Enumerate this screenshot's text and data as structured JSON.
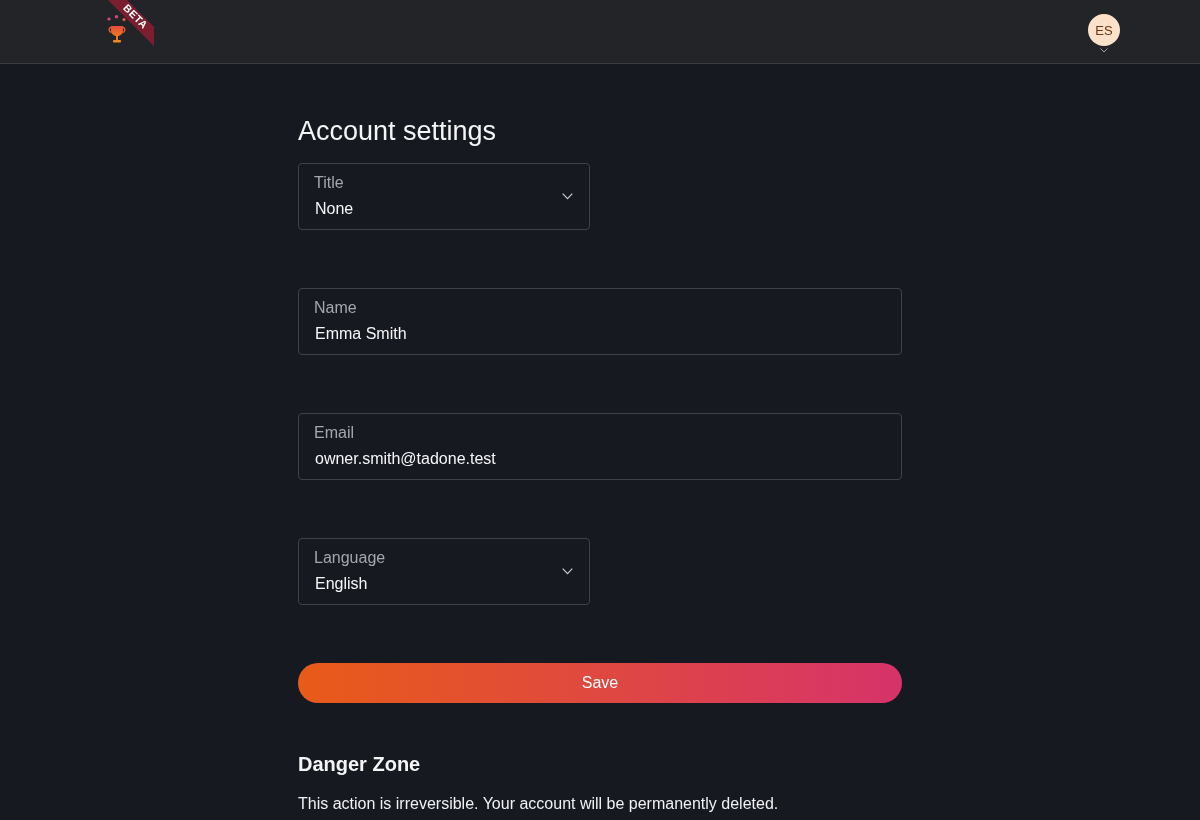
{
  "header": {
    "logo_ribbon": "BETA",
    "avatar": {
      "initials": "ES"
    }
  },
  "page": {
    "title": "Account settings"
  },
  "fields": [
    {
      "kind": "select",
      "label": "Title",
      "value": "None"
    },
    {
      "kind": "text",
      "label": "Name",
      "value": "Emma Smith"
    },
    {
      "kind": "text",
      "label": "Email",
      "value": "owner.smith@tadone.test"
    },
    {
      "kind": "select",
      "label": "Language",
      "value": "English"
    }
  ],
  "save_button": {
    "label": "Save"
  },
  "danger_zone": {
    "title": "Danger Zone",
    "text": "This action is irreversible. Your account will be permanently deleted."
  }
}
